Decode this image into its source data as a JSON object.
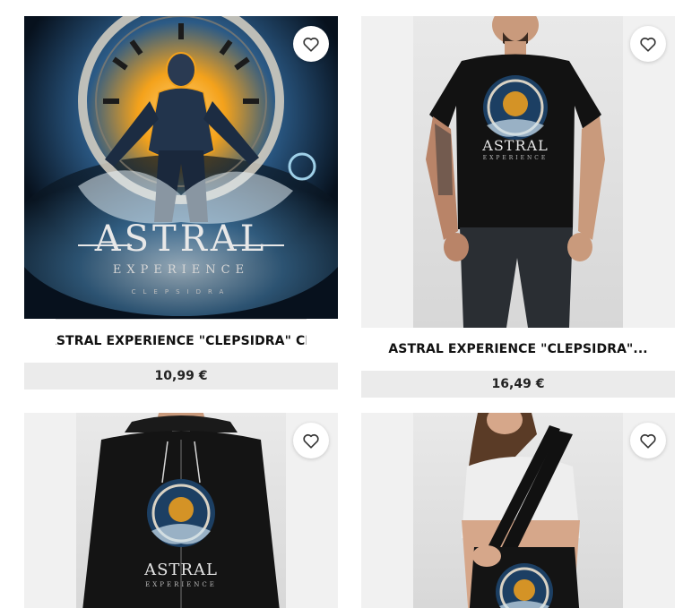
{
  "products": [
    {
      "title": "ASTRAL EXPERIENCE \"CLEPSIDRA\" CD",
      "price": "10,99 €",
      "art_title": "ASTRAL",
      "art_subtitle": "EXPERIENCE",
      "art_album": "CLEPSIDRA",
      "wishlist_icon": "heart-outline-icon"
    },
    {
      "title": "ASTRAL EXPERIENCE \"CLEPSIDRA\"...",
      "price": "16,49 €",
      "art_title": "ASTRAL",
      "art_subtitle": "EXPERIENCE",
      "wishlist_icon": "heart-outline-icon"
    },
    {
      "art_title": "ASTRAL",
      "art_subtitle": "EXPERIENCE",
      "wishlist_icon": "heart-outline-icon"
    },
    {
      "wishlist_icon": "heart-outline-icon"
    }
  ],
  "colors": {
    "price_bg": "#ebebeb",
    "title_text": "#111111",
    "art_gold": "#f4a21b",
    "art_blue": "#1c4a78"
  }
}
